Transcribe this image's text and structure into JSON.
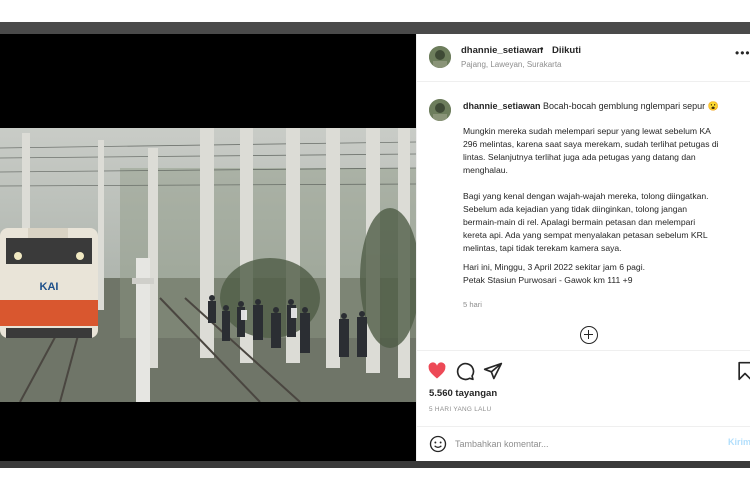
{
  "post": {
    "username": "dhannie_setiawan",
    "separator": "•",
    "follow_status": "Diikuti",
    "location": "Pajang, Laweyan, Surakarta",
    "caption_title": "Bocah-bocah gemblung nglempari sepur 😮",
    "caption_p1": "Mungkin mereka sudah melempari sepur yang lewat sebelum KA\n296 melintas, karena saat saya merekam, sudah terlihat petugas di\nlintas. Selanjutnya terlihat juga ada petugas yang datang dan\nmenghalau.",
    "caption_p2": "Bagi yang kenal dengan wajah-wajah mereka, tolong diingatkan.\nSebelum ada kejadian yang tidak diinginkan, tolong jangan\nbermain-main di rel. Apalagi bermain petasan dan melempari\nkereta api. Ada yang sempat menyalakan petasan sebelum KRL\nmelintas, tapi tidak terekam kamera saya.",
    "caption_p3": "Hari ini, Minggu, 3 April 2022 sekitar jam 6 pagi.\nPetak Stasiun Purwosari - Gawok km 111 +9",
    "caption_age": "5 hari",
    "views": "5.560 tayangan",
    "posted_ago": "5 HARI YANG LALU"
  },
  "comment": {
    "placeholder": "Tambahkan komentar...",
    "post_label": "Kirim"
  },
  "video": {
    "train_logo": "KAI"
  },
  "icons": {
    "more": "more-options-icon",
    "like": "heart-icon",
    "comment": "comment-icon",
    "share": "share-icon",
    "save": "bookmark-icon",
    "emoji": "emoji-icon",
    "mute": "muted-speaker-icon",
    "load_more": "plus-circle-icon"
  },
  "colors": {
    "like_red": "#ed4956",
    "post_button": "#b2dffc",
    "secondary_text": "#8e8e8e"
  }
}
